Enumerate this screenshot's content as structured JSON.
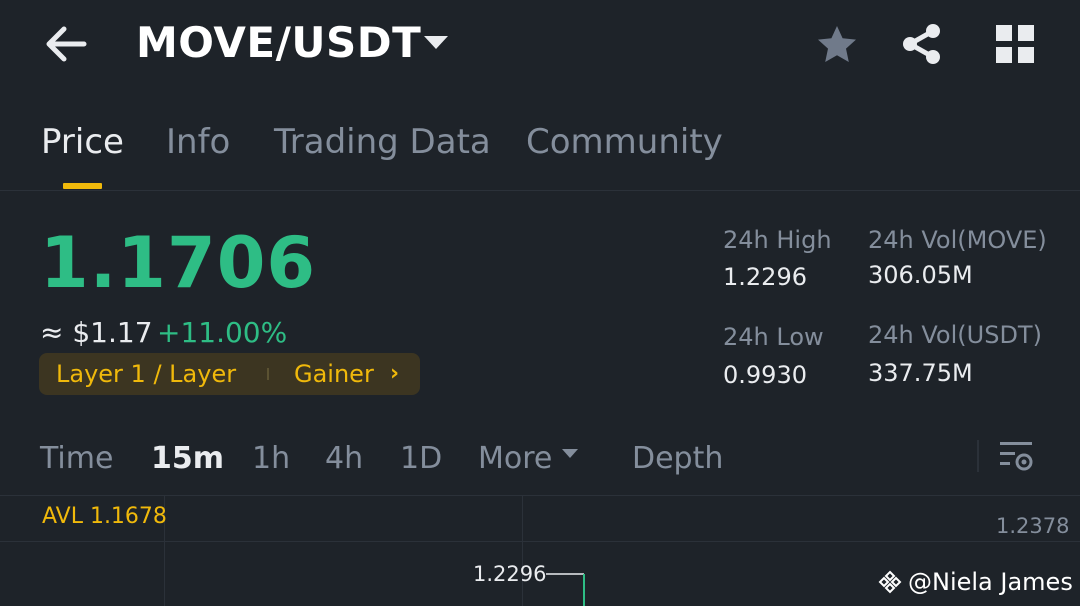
{
  "header": {
    "pair": "MOVE/USDT",
    "icons": [
      "back-arrow-icon",
      "dropdown-caret-icon",
      "star-icon",
      "share-icon",
      "grid-icon"
    ]
  },
  "tabs": [
    {
      "label": "Price",
      "active": true
    },
    {
      "label": "Info",
      "active": false
    },
    {
      "label": "Trading Data",
      "active": false
    },
    {
      "label": "Community",
      "active": false
    }
  ],
  "price": {
    "last": "1.1706",
    "approx": "≈ $1.17",
    "change": "+11.00%",
    "tag_category": "Layer 1 / Layer",
    "tag_rank": "Gainer",
    "tag_chevron": "›"
  },
  "stats": {
    "high_label": "24h High",
    "high_value": "1.2296",
    "vol_base_label": "24h Vol(MOVE)",
    "vol_base_value": "306.05M",
    "low_label": "24h Low",
    "low_value": "0.9930",
    "vol_quote_label": "24h Vol(USDT)",
    "vol_quote_value": "337.75M"
  },
  "intervals": {
    "time": "Time",
    "m15": "15m",
    "h1": "1h",
    "h4": "4h",
    "d1": "1D",
    "more": "More",
    "depth": "Depth",
    "selected": "15m"
  },
  "chart": {
    "avl": "AVL 1.1678",
    "axis_top": "1.2378",
    "high_marker": "1.2296"
  },
  "watermark": "@Niela James",
  "colors": {
    "background": "#1e2329",
    "up_green": "#2ebd85",
    "accent_yellow": "#f0b90b",
    "muted_text": "#848e9c"
  }
}
